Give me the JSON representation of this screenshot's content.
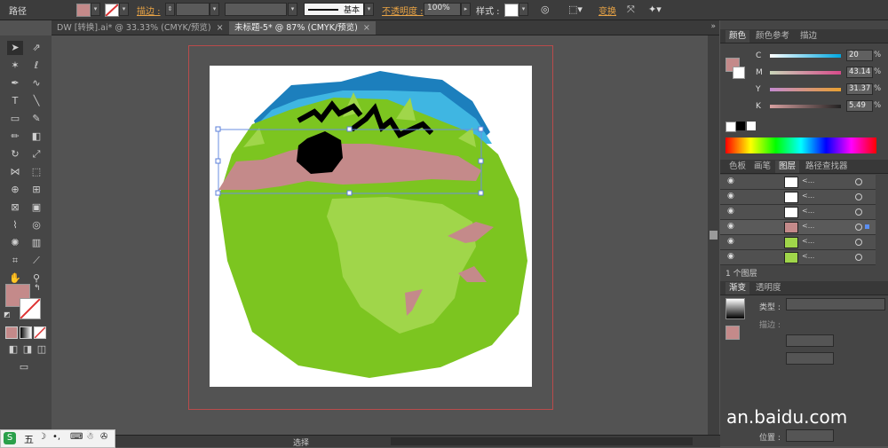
{
  "control_bar": {
    "object_type": "路径",
    "stroke_label": "描边 :",
    "stroke_profile_label": "基本",
    "opacity_label": "不透明度 :",
    "opacity_value": "100%",
    "style_label": "样式 :",
    "transform_label": "变换",
    "fill_color": "#c48a8a"
  },
  "tabs": [
    {
      "label": "DW [转换].ai* @ 33.33% (CMYK/预览)"
    },
    {
      "label": "未标题-5* @ 87% (CMYK/预览)"
    }
  ],
  "color_panel": {
    "tabs": [
      "颜色",
      "颜色参考",
      "描边"
    ],
    "channels": [
      {
        "name": "C",
        "value": "20",
        "unit": "%"
      },
      {
        "name": "M",
        "value": "43.14",
        "unit": "%"
      },
      {
        "name": "Y",
        "value": "31.37",
        "unit": "%"
      },
      {
        "name": "K",
        "value": "5.49",
        "unit": "%"
      }
    ]
  },
  "layers_panel": {
    "tabs": [
      "色板",
      "画笔",
      "图层",
      "路径查找器"
    ],
    "rows": [
      {
        "name": "<..."
      },
      {
        "name": "<..."
      },
      {
        "name": "<..."
      },
      {
        "name": "<..."
      },
      {
        "name": "<..."
      },
      {
        "name": "<..."
      }
    ],
    "footer": "1 个图层"
  },
  "gradient_panel": {
    "tabs": [
      "渐变",
      "透明度"
    ],
    "type_label": "类型 :",
    "stroke_label": "描边 :",
    "position_label": "位置 :"
  },
  "status_bar": {
    "tool_label": "选择"
  },
  "watermark": "an.baidu.com",
  "ime_label": "五"
}
